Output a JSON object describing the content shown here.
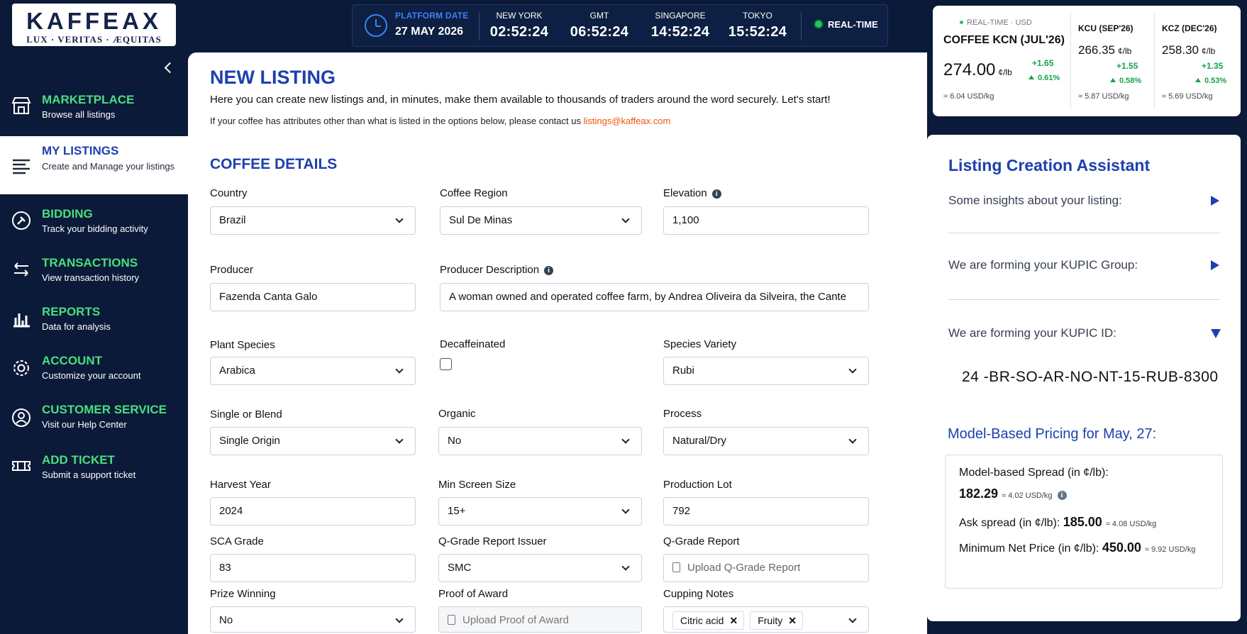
{
  "logo": {
    "brand": "KAFFEA",
    "mark": "X",
    "motto": "LUX · VERITAS · ÆQUITAS"
  },
  "clock": {
    "platform_label": "PLATFORM DATE",
    "platform_date": "27 MAY 2026",
    "zones": [
      {
        "label": "NEW YORK",
        "time": "02:52:24"
      },
      {
        "label": "GMT",
        "time": "06:52:24"
      },
      {
        "label": "SINGAPORE",
        "time": "14:52:24"
      },
      {
        "label": "TOKYO",
        "time": "15:52:24"
      }
    ],
    "realtime": "REAL-TIME"
  },
  "ticker": {
    "realtime_label": "REAL-TIME · USD",
    "items": [
      {
        "name": "COFFEE KCN (JUL'26)",
        "price": "274.00",
        "unit": "¢/lb",
        "change": "+1.65",
        "pct": "0.61%",
        "kg": "≈ 6.04 USD/kg"
      },
      {
        "name": "KCU (SEP'26)",
        "price": "266.35",
        "unit": "¢/lb",
        "change": "+1.55",
        "pct": "0.58%",
        "kg": "≈ 5.87 USD/kg"
      },
      {
        "name": "KCZ (DEC'26)",
        "price": "258.30",
        "unit": "¢/lb",
        "change": "+1.35",
        "pct": "0.53%",
        "kg": "≈ 5.69 USD/kg"
      }
    ]
  },
  "sidebar": {
    "items": [
      {
        "title": "MARKETPLACE",
        "sub": "Browse all listings",
        "icon": "store-icon"
      },
      {
        "title": "MY LISTINGS",
        "sub": "Create and Manage your listings",
        "icon": "list-icon",
        "active": true
      },
      {
        "title": "BIDDING",
        "sub": "Track your bidding activity",
        "icon": "bidding-icon"
      },
      {
        "title": "TRANSACTIONS",
        "sub": "View transaction history",
        "icon": "arrows-icon"
      },
      {
        "title": "REPORTS",
        "sub": "Data for analysis",
        "icon": "chart-icon"
      },
      {
        "title": "ACCOUNT",
        "sub": "Customize your account",
        "icon": "gear-icon"
      },
      {
        "title": "CUSTOMER SERVICE",
        "sub": "Visit our Help Center",
        "icon": "user-icon"
      },
      {
        "title": "ADD TICKET",
        "sub": "Submit a support ticket",
        "icon": "ticket-icon"
      }
    ]
  },
  "main": {
    "title": "NEW LISTING",
    "intro": "Here you can create new listings and, in minutes, make them available to thousands of traders around the word securely. Let's start!",
    "intro2": "If your coffee has attributes other than what is listed in the options below, please contact us ",
    "email": "listings@kaffeax.com",
    "section": "COFFEE DETAILS"
  },
  "form": {
    "country": {
      "label": "Country",
      "value": "Brazil"
    },
    "region": {
      "label": "Coffee Region",
      "value": "Sul De Minas"
    },
    "elevation": {
      "label": "Elevation",
      "value": "1,100"
    },
    "producer": {
      "label": "Producer",
      "value": "Fazenda Canta Galo"
    },
    "producer_desc": {
      "label": "Producer Description",
      "value": "A woman owned and operated coffee farm, by Andrea Oliveira da Silveira, the Cante"
    },
    "species": {
      "label": "Plant Species",
      "value": "Arabica"
    },
    "decaf": {
      "label": "Decaffeinated"
    },
    "variety": {
      "label": "Species Variety",
      "value": "Rubi"
    },
    "blend": {
      "label": "Single or Blend",
      "value": "Single Origin"
    },
    "organic": {
      "label": "Organic",
      "value": "No"
    },
    "process": {
      "label": "Process",
      "value": "Natural/Dry"
    },
    "harvest": {
      "label": "Harvest Year",
      "value": "2024"
    },
    "screen": {
      "label": "Min Screen Size",
      "value": "15+"
    },
    "lot": {
      "label": "Production Lot",
      "value": "792"
    },
    "sca": {
      "label": "SCA Grade",
      "value": "83"
    },
    "issuer": {
      "label": "Q-Grade Report Issuer",
      "value": "SMC"
    },
    "qgrade": {
      "label": "Q-Grade Report",
      "placeholder": "Upload Q-Grade Report"
    },
    "prize": {
      "label": "Prize Winning",
      "value": "No"
    },
    "award": {
      "label": "Proof of Award",
      "placeholder": "Upload Proof of Award"
    },
    "cupping": {
      "label": "Cupping Notes",
      "chips": [
        "Citric acid",
        "Fruity"
      ]
    }
  },
  "assistant": {
    "title": "Listing Creation Assistant",
    "rows": [
      "Some insights about your listing:",
      "We are forming your KUPIC Group:",
      "We are forming your KUPIC ID:"
    ],
    "kupic_id": "24 -BR-SO-AR-NO-NT-15-RUB-8300",
    "pricing_title": "Model-Based Pricing for May, 27:",
    "spread_label": "Model-based Spread (in ¢/lb):",
    "spread_value": "182.29",
    "spread_kg": "≈ 4.02 USD/kg",
    "ask_label": "Ask spread (in ¢/lb): ",
    "ask_value": "185.00",
    "ask_kg": "≈ 4.08 USD/kg",
    "min_label": "Minimum Net Price (in ¢/lb): ",
    "min_value": "450.00",
    "min_kg": "≈ 9.92 USD/kg"
  }
}
